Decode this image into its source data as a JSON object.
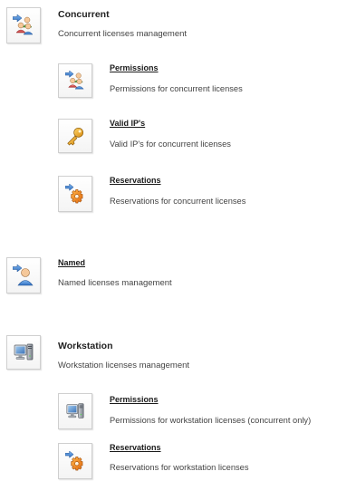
{
  "concurrent": {
    "title": "Concurrent",
    "description": "Concurrent licenses management",
    "icon": "users-group-icon",
    "items": [
      {
        "label": "Permissions",
        "description": "Permissions for concurrent licenses",
        "icon": "users-group-icon"
      },
      {
        "label": "Valid IP's",
        "description": "Valid IP's for concurrent licenses",
        "icon": "key-icon"
      },
      {
        "label": "Reservations",
        "description": "Reservations for concurrent licenses",
        "icon": "gear-icon"
      }
    ]
  },
  "named": {
    "title": "Named",
    "description": "Named licenses management",
    "icon": "user-icon"
  },
  "workstation": {
    "title": "Workstation",
    "description": "Workstation licenses management",
    "icon": "computer-icon",
    "items": [
      {
        "label": "Permissions",
        "description": "Permissions for workstation licenses (concurrent only)",
        "icon": "computer-icon"
      },
      {
        "label": "Reservations",
        "description": "Reservations for workstation licenses",
        "icon": "gear-icon"
      }
    ]
  }
}
